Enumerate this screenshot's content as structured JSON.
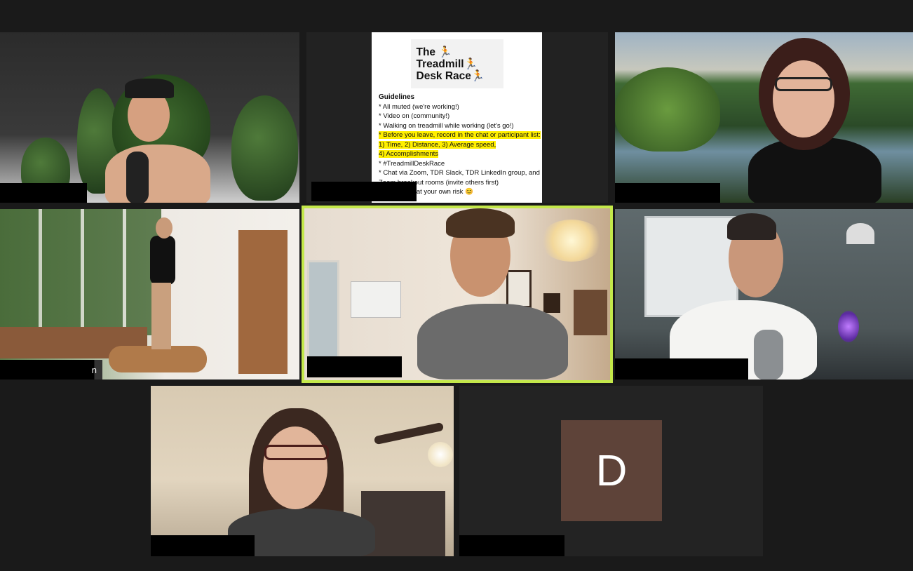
{
  "app": "Zoom Gallery View",
  "colors": {
    "active_speaker_border": "#d8f06a",
    "avatar_bg": "#5e4339",
    "background": "#1a1a1a"
  },
  "tiles": [
    {
      "id": "p1",
      "name": ""
    },
    {
      "id": "p2",
      "name": ""
    },
    {
      "id": "p3",
      "name": ""
    },
    {
      "id": "p4",
      "name": "n"
    },
    {
      "id": "p5",
      "name": "",
      "active": true
    },
    {
      "id": "p6",
      "name": ""
    },
    {
      "id": "p7",
      "name": ""
    },
    {
      "id": "p8",
      "name": ""
    }
  ],
  "shared_slide": {
    "logo_line1": "The 🏃",
    "logo_line2": "Treadmill🏃",
    "logo_line3": "Desk Race🏃",
    "heading": "Guidelines",
    "lines": [
      "* All muted (we're working!)",
      "* Video on (community!)",
      "* Walking on treadmill while working (let's go!)",
      "* Before you leave, record in the chat or participant list:",
      "1) Time, 2) Distance, 3) Average speed,",
      " 4) Accomplishments",
      "* #TreadmillDeskRace",
      "* Chat via Zoom, TDR Slack, TDR LinkedIn group, and",
      "  Zoom breakout rooms (invite others first)",
      "* Participate at your own risk 😊"
    ]
  },
  "avatar_initial": "D"
}
